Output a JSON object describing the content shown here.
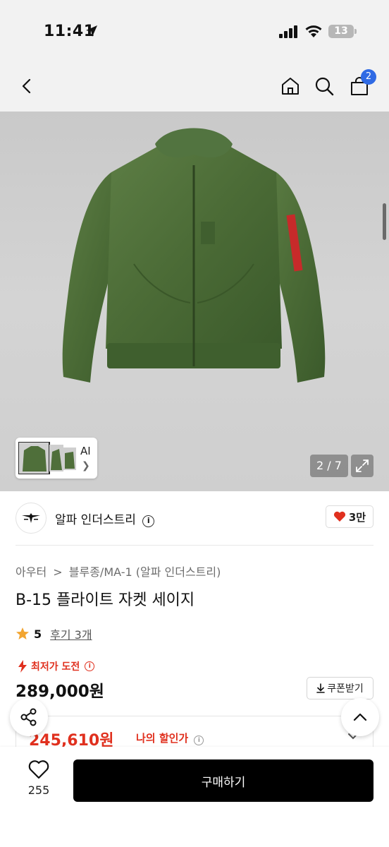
{
  "status_bar": {
    "time": "11:41",
    "battery": "13"
  },
  "header": {
    "cart_count": "2"
  },
  "gallery": {
    "thumb_label": "AI",
    "page_counter": "2 / 7"
  },
  "brand": {
    "name": "알파 인더스트리",
    "info": "i",
    "likes": "3만"
  },
  "product": {
    "breadcrumb": [
      "아우터",
      "블루종/MA-1 (알파 인더스트리)"
    ],
    "breadcrumb_sep": ">",
    "title": "B-15 플라이트 자켓 세이지",
    "rating": "5",
    "review_link": "후기 3개",
    "lowest_label": "최저가 도전",
    "price": "289,000원",
    "coupon_label": "쿠폰받기",
    "discount_price": "245,610원",
    "discount_label": "나의 할인가"
  },
  "bottom_bar": {
    "wish_count": "255",
    "buy_label": "구매하기"
  },
  "colors": {
    "accent_red": "#e0301e",
    "badge_blue": "#2f6ae4",
    "jacket_green": "#4f6f3a"
  }
}
